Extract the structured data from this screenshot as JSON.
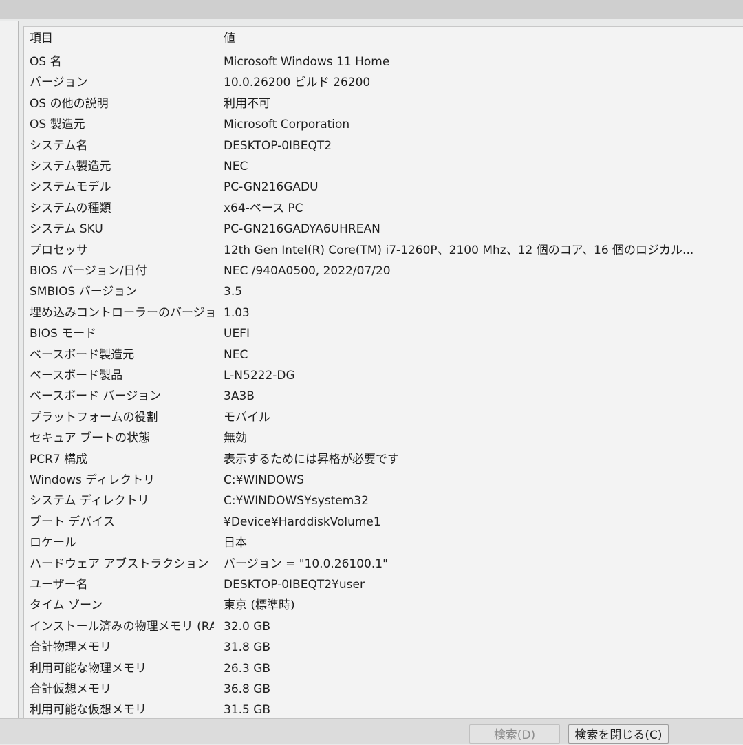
{
  "table": {
    "header": {
      "item": "項目",
      "value": "値"
    },
    "rows": [
      {
        "item": "OS 名",
        "value": "Microsoft Windows 11 Home"
      },
      {
        "item": "バージョン",
        "value": "10.0.26200 ビルド 26200"
      },
      {
        "item": "OS の他の説明",
        "value": "利用不可"
      },
      {
        "item": "OS 製造元",
        "value": "Microsoft Corporation"
      },
      {
        "item": "システム名",
        "value": "DESKTOP-0IBEQT2"
      },
      {
        "item": "システム製造元",
        "value": "NEC"
      },
      {
        "item": "システムモデル",
        "value": "PC-GN216GADU"
      },
      {
        "item": "システムの種類",
        "value": "x64-ベース PC"
      },
      {
        "item": "システム SKU",
        "value": "PC-GN216GADYA6UHREAN"
      },
      {
        "item": "プロセッサ",
        "value": "12th Gen Intel(R) Core(TM) i7-1260P、2100 Mhz、12 個のコア、16 個のロジカル..."
      },
      {
        "item": "BIOS バージョン/日付",
        "value": "NEC /940A0500, 2022/07/20"
      },
      {
        "item": "SMBIOS バージョン",
        "value": "3.5"
      },
      {
        "item": "埋め込みコントローラーのバージョン",
        "value": "1.03"
      },
      {
        "item": "BIOS モード",
        "value": "UEFI"
      },
      {
        "item": "ベースボード製造元",
        "value": "NEC"
      },
      {
        "item": "ベースボード製品",
        "value": "L-N5222-DG"
      },
      {
        "item": "ベースボード バージョン",
        "value": "3A3B"
      },
      {
        "item": "プラットフォームの役割",
        "value": "モバイル"
      },
      {
        "item": "セキュア ブートの状態",
        "value": "無効"
      },
      {
        "item": "PCR7 構成",
        "value": "表示するためには昇格が必要です"
      },
      {
        "item": "Windows ディレクトリ",
        "value": "C:¥WINDOWS"
      },
      {
        "item": "システム ディレクトリ",
        "value": "C:¥WINDOWS¥system32"
      },
      {
        "item": "ブート デバイス",
        "value": "¥Device¥HarddiskVolume1"
      },
      {
        "item": "ロケール",
        "value": "日本"
      },
      {
        "item": "ハードウェア アブストラクション レイ...",
        "value": "バージョン = \"10.0.26100.1\""
      },
      {
        "item": "ユーザー名",
        "value": "DESKTOP-0IBEQT2¥user"
      },
      {
        "item": "タイム ゾーン",
        "value": "東京 (標準時)"
      },
      {
        "item": "インストール済みの物理メモリ (RA...",
        "value": "32.0 GB"
      },
      {
        "item": "合計物理メモリ",
        "value": "31.8 GB"
      },
      {
        "item": "利用可能な物理メモリ",
        "value": "26.3 GB"
      },
      {
        "item": "合計仮想メモリ",
        "value": "36.8 GB"
      },
      {
        "item": "利用可能な仮想メモリ",
        "value": "31.5 GB"
      }
    ]
  },
  "buttons": {
    "search": "検索(D)",
    "close_search": "検索を閉じる(C)"
  }
}
